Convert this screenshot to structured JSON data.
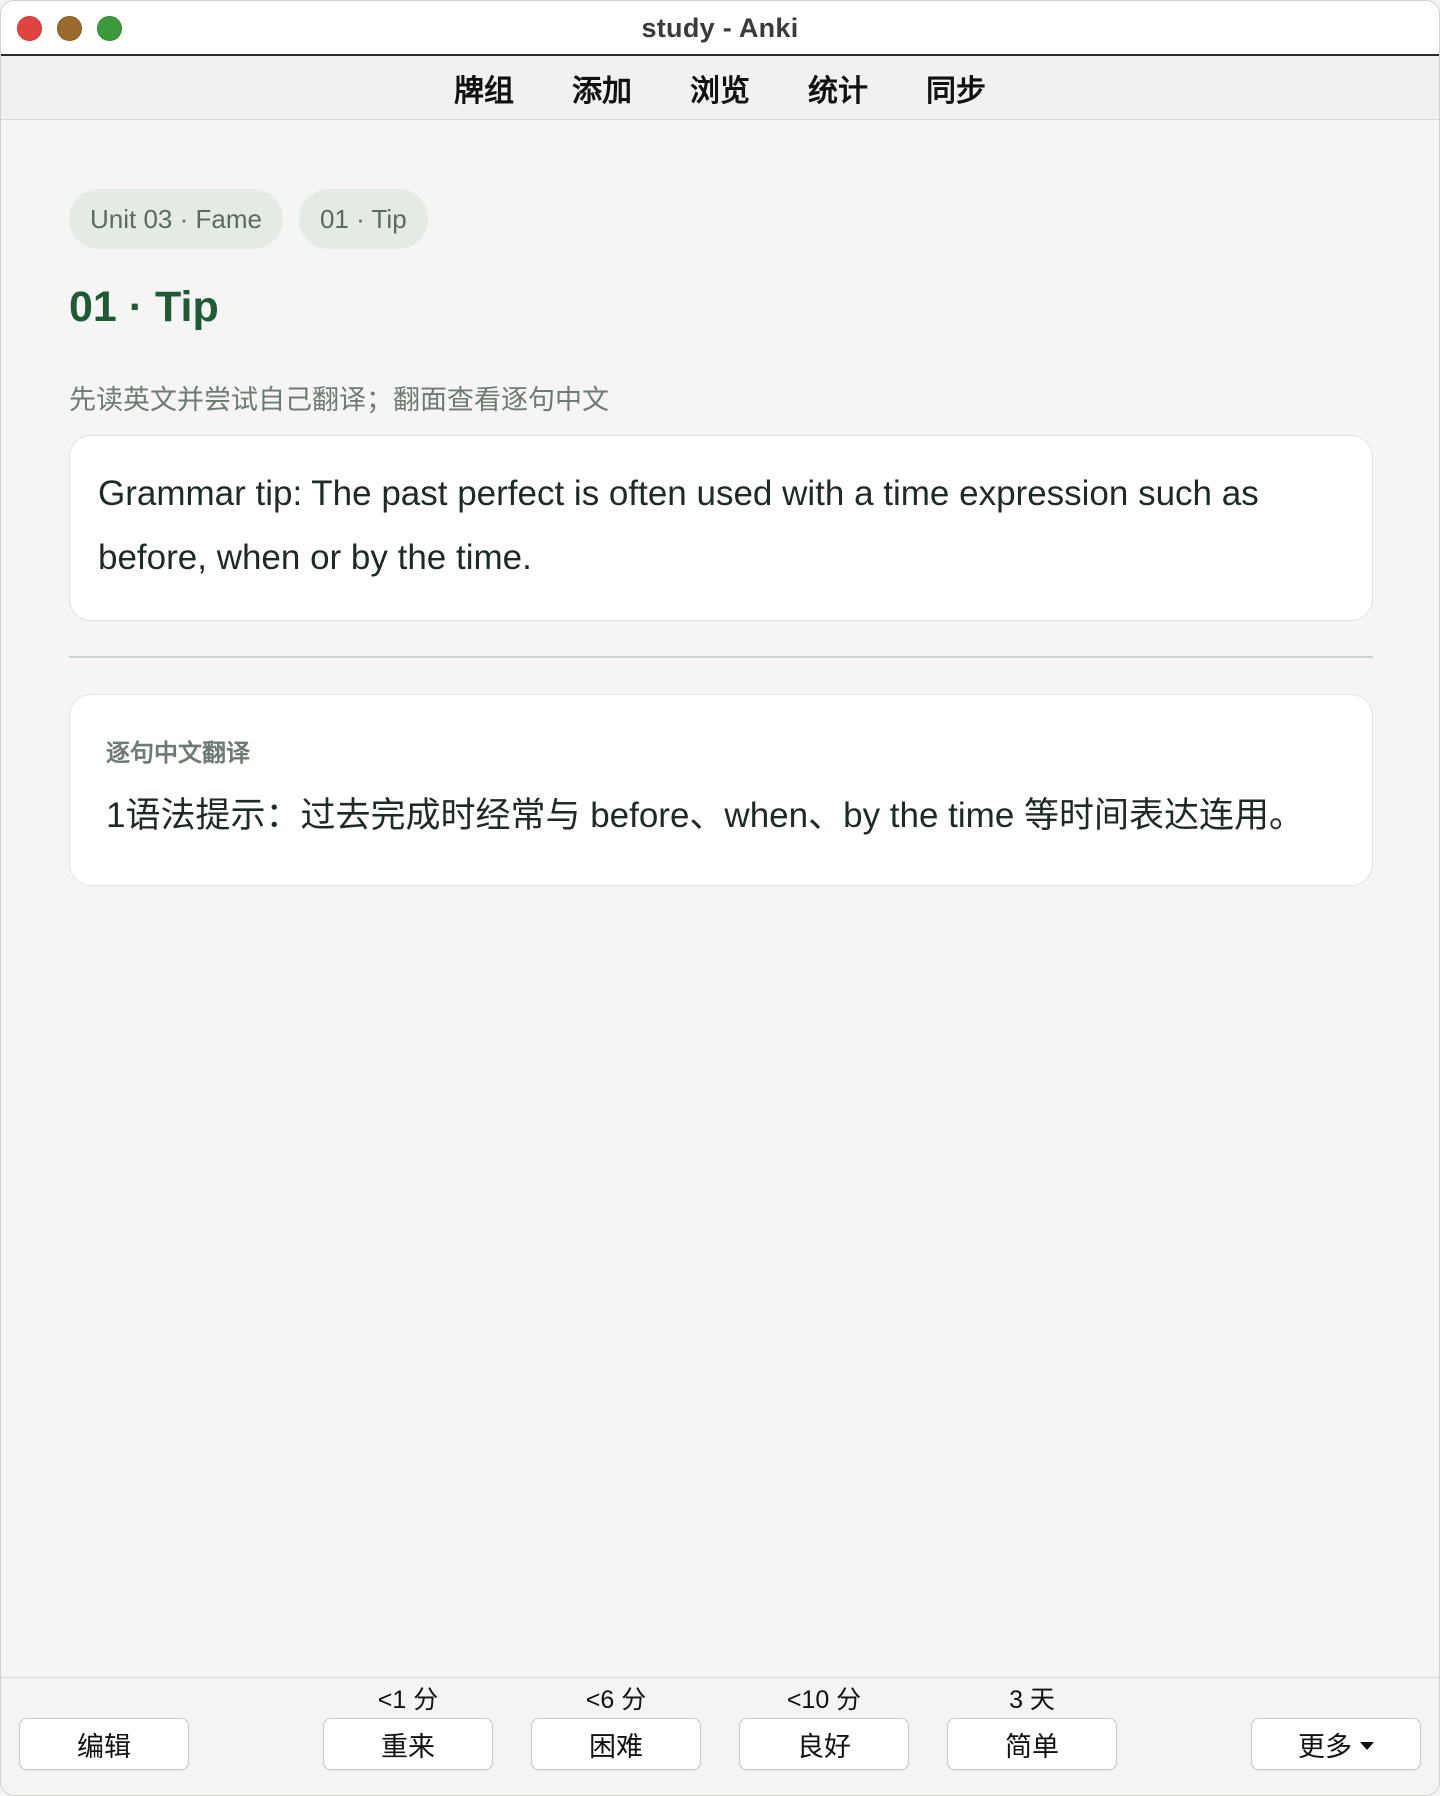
{
  "window": {
    "title": "study - Anki"
  },
  "topmenu": {
    "items": [
      "牌组",
      "添加",
      "浏览",
      "统计",
      "同步"
    ]
  },
  "card": {
    "chips": [
      "Unit 03 · Fame",
      "01 · Tip"
    ],
    "title": "01 · Tip",
    "instruction": "先读英文并尝试自己翻译；翻面查看逐句中文",
    "english": "Grammar tip: The past perfect is often used with a time expression such as before, when or by the time.",
    "translation_label": "逐句中文翻译",
    "translation": "1语法提示：过去完成时经常与 before、when、by the time 等时间表达连用。"
  },
  "bottombar": {
    "edit_label": "编辑",
    "more_label": "更多",
    "answers": [
      {
        "time": "<1 分",
        "label": "重来"
      },
      {
        "time": "<6 分",
        "label": "困难"
      },
      {
        "time": "<10 分",
        "label": "良好"
      },
      {
        "time": "3 天",
        "label": "简单"
      }
    ]
  },
  "colors": {
    "accent_green": "#1e5a34",
    "chip_bg": "#e4ebe5",
    "close": "#e0443e",
    "minimize": "#9a6b2c",
    "maximize": "#3c9a3a"
  }
}
